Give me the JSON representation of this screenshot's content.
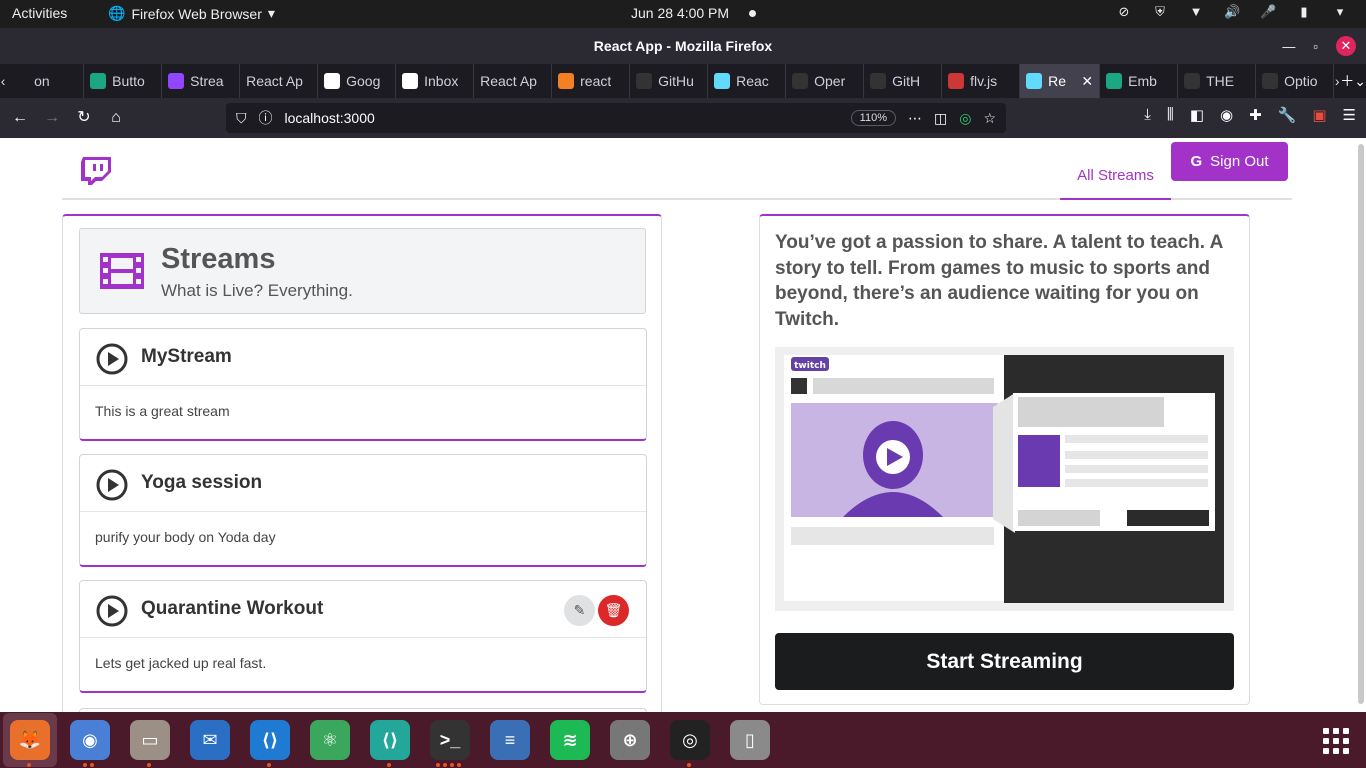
{
  "system": {
    "activities": "Activities",
    "app_menu": "Firefox Web Browser",
    "clock": "Jun 28   4:00 PM"
  },
  "window": {
    "title": "React App - Mozilla Firefox"
  },
  "tabs": [
    {
      "label": "on",
      "icon": "generic-tab-icon",
      "color": "#1c1b22"
    },
    {
      "label": "Butto",
      "icon": "stackblitz-icon",
      "color": "#1ba784"
    },
    {
      "label": "Strea",
      "icon": "twitch-icon",
      "color": "#9146ff"
    },
    {
      "label": "React Ap",
      "icon": "none",
      "color": "#1c1b22"
    },
    {
      "label": "Goog",
      "icon": "google-icon",
      "color": "#ffffff"
    },
    {
      "label": "Inbox",
      "icon": "gmail-icon",
      "color": "#ffffff"
    },
    {
      "label": "React Ap",
      "icon": "none",
      "color": "#1c1b22"
    },
    {
      "label": "react",
      "icon": "stackoverflow-icon",
      "color": "#f48024"
    },
    {
      "label": "GitHu",
      "icon": "github-icon",
      "color": "#333333"
    },
    {
      "label": "Reac",
      "icon": "react-icon",
      "color": "#61dafb"
    },
    {
      "label": "Oper",
      "icon": "openai-icon",
      "color": "#333333"
    },
    {
      "label": "GitH",
      "icon": "github-icon",
      "color": "#333333"
    },
    {
      "label": "flv.js",
      "icon": "npm-icon",
      "color": "#cb3837"
    },
    {
      "label": "Re",
      "icon": "react-icon",
      "color": "#61dafb",
      "active": true
    },
    {
      "label": "Emb",
      "icon": "stackblitz-icon",
      "color": "#1ba784"
    },
    {
      "label": "THE",
      "icon": "github-icon",
      "color": "#333333"
    },
    {
      "label": "Optio",
      "icon": "github-icon",
      "color": "#333333"
    }
  ],
  "navbar": {
    "url": "localhost:3000",
    "zoom": "110%"
  },
  "app": {
    "nav": {
      "all_streams": "All Streams",
      "sign_out": "Sign Out"
    },
    "streams_header": {
      "title": "Streams",
      "subtitle": "What is Live? Everything."
    },
    "streams": [
      {
        "title": "MyStream",
        "description": "This is a great stream",
        "owned": false
      },
      {
        "title": "Yoga session",
        "description": "purify your body on Yoda day",
        "owned": false
      },
      {
        "title": "Quarantine Workout",
        "description": "Lets get jacked up real fast.",
        "owned": true
      }
    ],
    "pitch": "You’ve got a passion to share. A talent to teach. A story to tell. From games to music to sports and beyond, there’s an audience waiting for you on Twitch.",
    "illustration_logo": "twitch",
    "start_button": "Start Streaming",
    "accent_color": "#a333c8",
    "delete_color": "#db2828"
  },
  "dock": [
    {
      "name": "firefox-icon",
      "glyph": "🦊",
      "bg": "#e8702a"
    },
    {
      "name": "chromium-icon",
      "glyph": "◉",
      "bg": "#4a7fd6"
    },
    {
      "name": "files-icon",
      "glyph": "▭",
      "bg": "#9b8f86"
    },
    {
      "name": "thunderbird-icon",
      "glyph": "✉",
      "bg": "#2b6fc4"
    },
    {
      "name": "vscode-icon",
      "glyph": "⟨⟩",
      "bg": "#1f7bd1"
    },
    {
      "name": "atom-icon",
      "glyph": "⚛",
      "bg": "#3aa75c"
    },
    {
      "name": "vscodium-icon",
      "glyph": "⟨⟩",
      "bg": "#22a79a"
    },
    {
      "name": "terminal-icon",
      "glyph": ">_",
      "bg": "#333333"
    },
    {
      "name": "text-editor-icon",
      "glyph": "≡",
      "bg": "#3b6fb5"
    },
    {
      "name": "spotify-icon",
      "glyph": "≋",
      "bg": "#1db954"
    },
    {
      "name": "vpn-icon",
      "glyph": "⊕",
      "bg": "#777777"
    },
    {
      "name": "obs-icon",
      "glyph": "◎",
      "bg": "#222222"
    },
    {
      "name": "usb-drive-icon",
      "glyph": "▯",
      "bg": "#8a8a8a"
    }
  ]
}
